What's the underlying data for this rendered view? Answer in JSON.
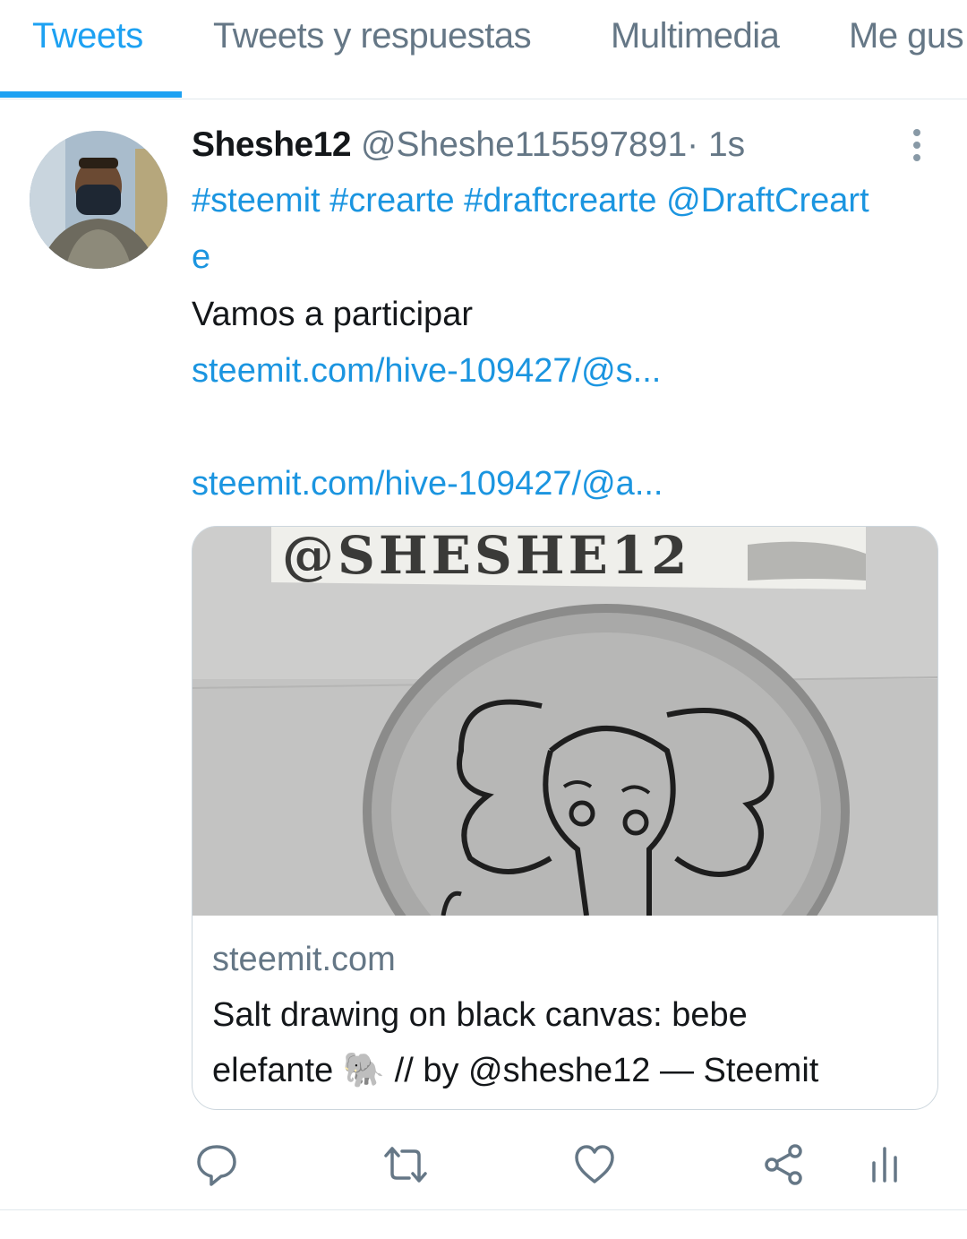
{
  "tabs": [
    {
      "label": "Tweets",
      "active": true
    },
    {
      "label": "Tweets y respuestas",
      "active": false
    },
    {
      "label": "Multimedia",
      "active": false
    },
    {
      "label": "Me gus",
      "active": false
    }
  ],
  "tweet": {
    "name": "Sheshe12",
    "handle": "@Sheshe115597891",
    "separator": "·",
    "time": "1s",
    "hashtags_line1": "#steemit #crearte #draftcrearte @DraftCreart",
    "hashtags_line2": "e",
    "text": "Vamos a participar",
    "link1": "steemit.com/hive-109427/@s...",
    "link2": "steemit.com/hive-109427/@a...",
    "card": {
      "image_sign_text": "@SHESHE12",
      "domain": "steemit.com",
      "title_line1": "Salt drawing on black canvas: bebe",
      "title_line2": "elefante 🐘 // by @sheshe12 — Steemit"
    },
    "actions": [
      "reply-icon",
      "retweet-icon",
      "like-icon",
      "share-icon",
      "analytics-icon"
    ]
  },
  "colors": {
    "accent": "#1da1f2",
    "link": "#1b95e0",
    "muted": "#657786",
    "divider": "#e1e8ed"
  }
}
